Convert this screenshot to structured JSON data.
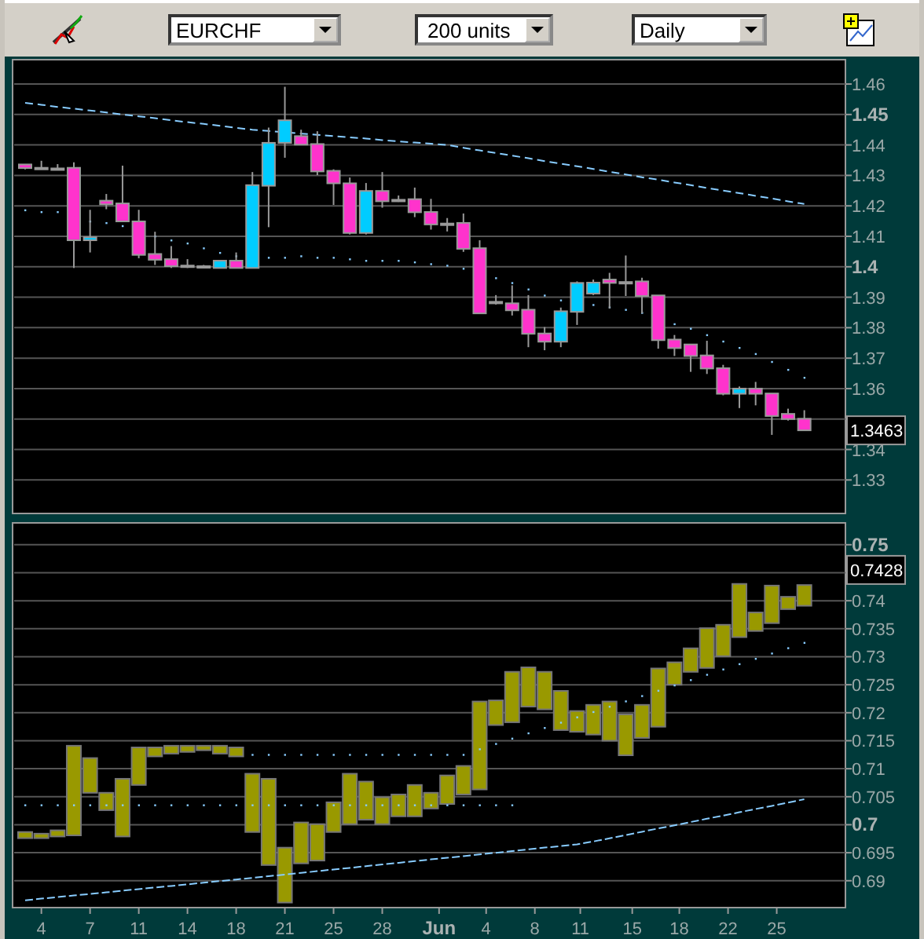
{
  "toolbar": {
    "symbol": {
      "value": "EURCHF"
    },
    "size": {
      "value": "200 units"
    },
    "period": {
      "value": "Daily"
    }
  },
  "price_pane": {
    "price_tag": "1.3463",
    "axis_labels": [
      {
        "text": "1.46",
        "major": false
      },
      {
        "text": "1.45",
        "major": true
      },
      {
        "text": "1.44",
        "major": false
      },
      {
        "text": "1.43",
        "major": false
      },
      {
        "text": "1.42",
        "major": false
      },
      {
        "text": "1.41",
        "major": false
      },
      {
        "text": "1.4",
        "major": true
      },
      {
        "text": "1.39",
        "major": false
      },
      {
        "text": "1.38",
        "major": false
      },
      {
        "text": "1.37",
        "major": false
      },
      {
        "text": "1.36",
        "major": false
      },
      {
        "text": "1.34",
        "major": false
      },
      {
        "text": "1.33",
        "major": false
      }
    ]
  },
  "indicator_pane": {
    "value_tag": "0.7428",
    "axis_labels": [
      {
        "text": "0.75",
        "major": true
      },
      {
        "text": "0.74",
        "major": false
      },
      {
        "text": "0.735",
        "major": false
      },
      {
        "text": "0.73",
        "major": false
      },
      {
        "text": "0.725",
        "major": false
      },
      {
        "text": "0.72",
        "major": false
      },
      {
        "text": "0.715",
        "major": false
      },
      {
        "text": "0.71",
        "major": false
      },
      {
        "text": "0.705",
        "major": false
      },
      {
        "text": "0.7",
        "major": true
      },
      {
        "text": "0.695",
        "major": false
      },
      {
        "text": "0.69",
        "major": false
      }
    ],
    "date_labels": [
      {
        "text": "4",
        "major": false
      },
      {
        "text": "7",
        "major": false
      },
      {
        "text": "11",
        "major": false
      },
      {
        "text": "14",
        "major": false
      },
      {
        "text": "18",
        "major": false
      },
      {
        "text": "21",
        "major": false
      },
      {
        "text": "25",
        "major": false
      },
      {
        "text": "28",
        "major": false
      },
      {
        "text": "Jun",
        "major": true
      },
      {
        "text": "4",
        "major": false
      },
      {
        "text": "8",
        "major": false
      },
      {
        "text": "11",
        "major": false
      },
      {
        "text": "15",
        "major": false
      },
      {
        "text": "18",
        "major": false
      },
      {
        "text": "22",
        "major": false
      },
      {
        "text": "25",
        "major": false
      }
    ]
  }
}
